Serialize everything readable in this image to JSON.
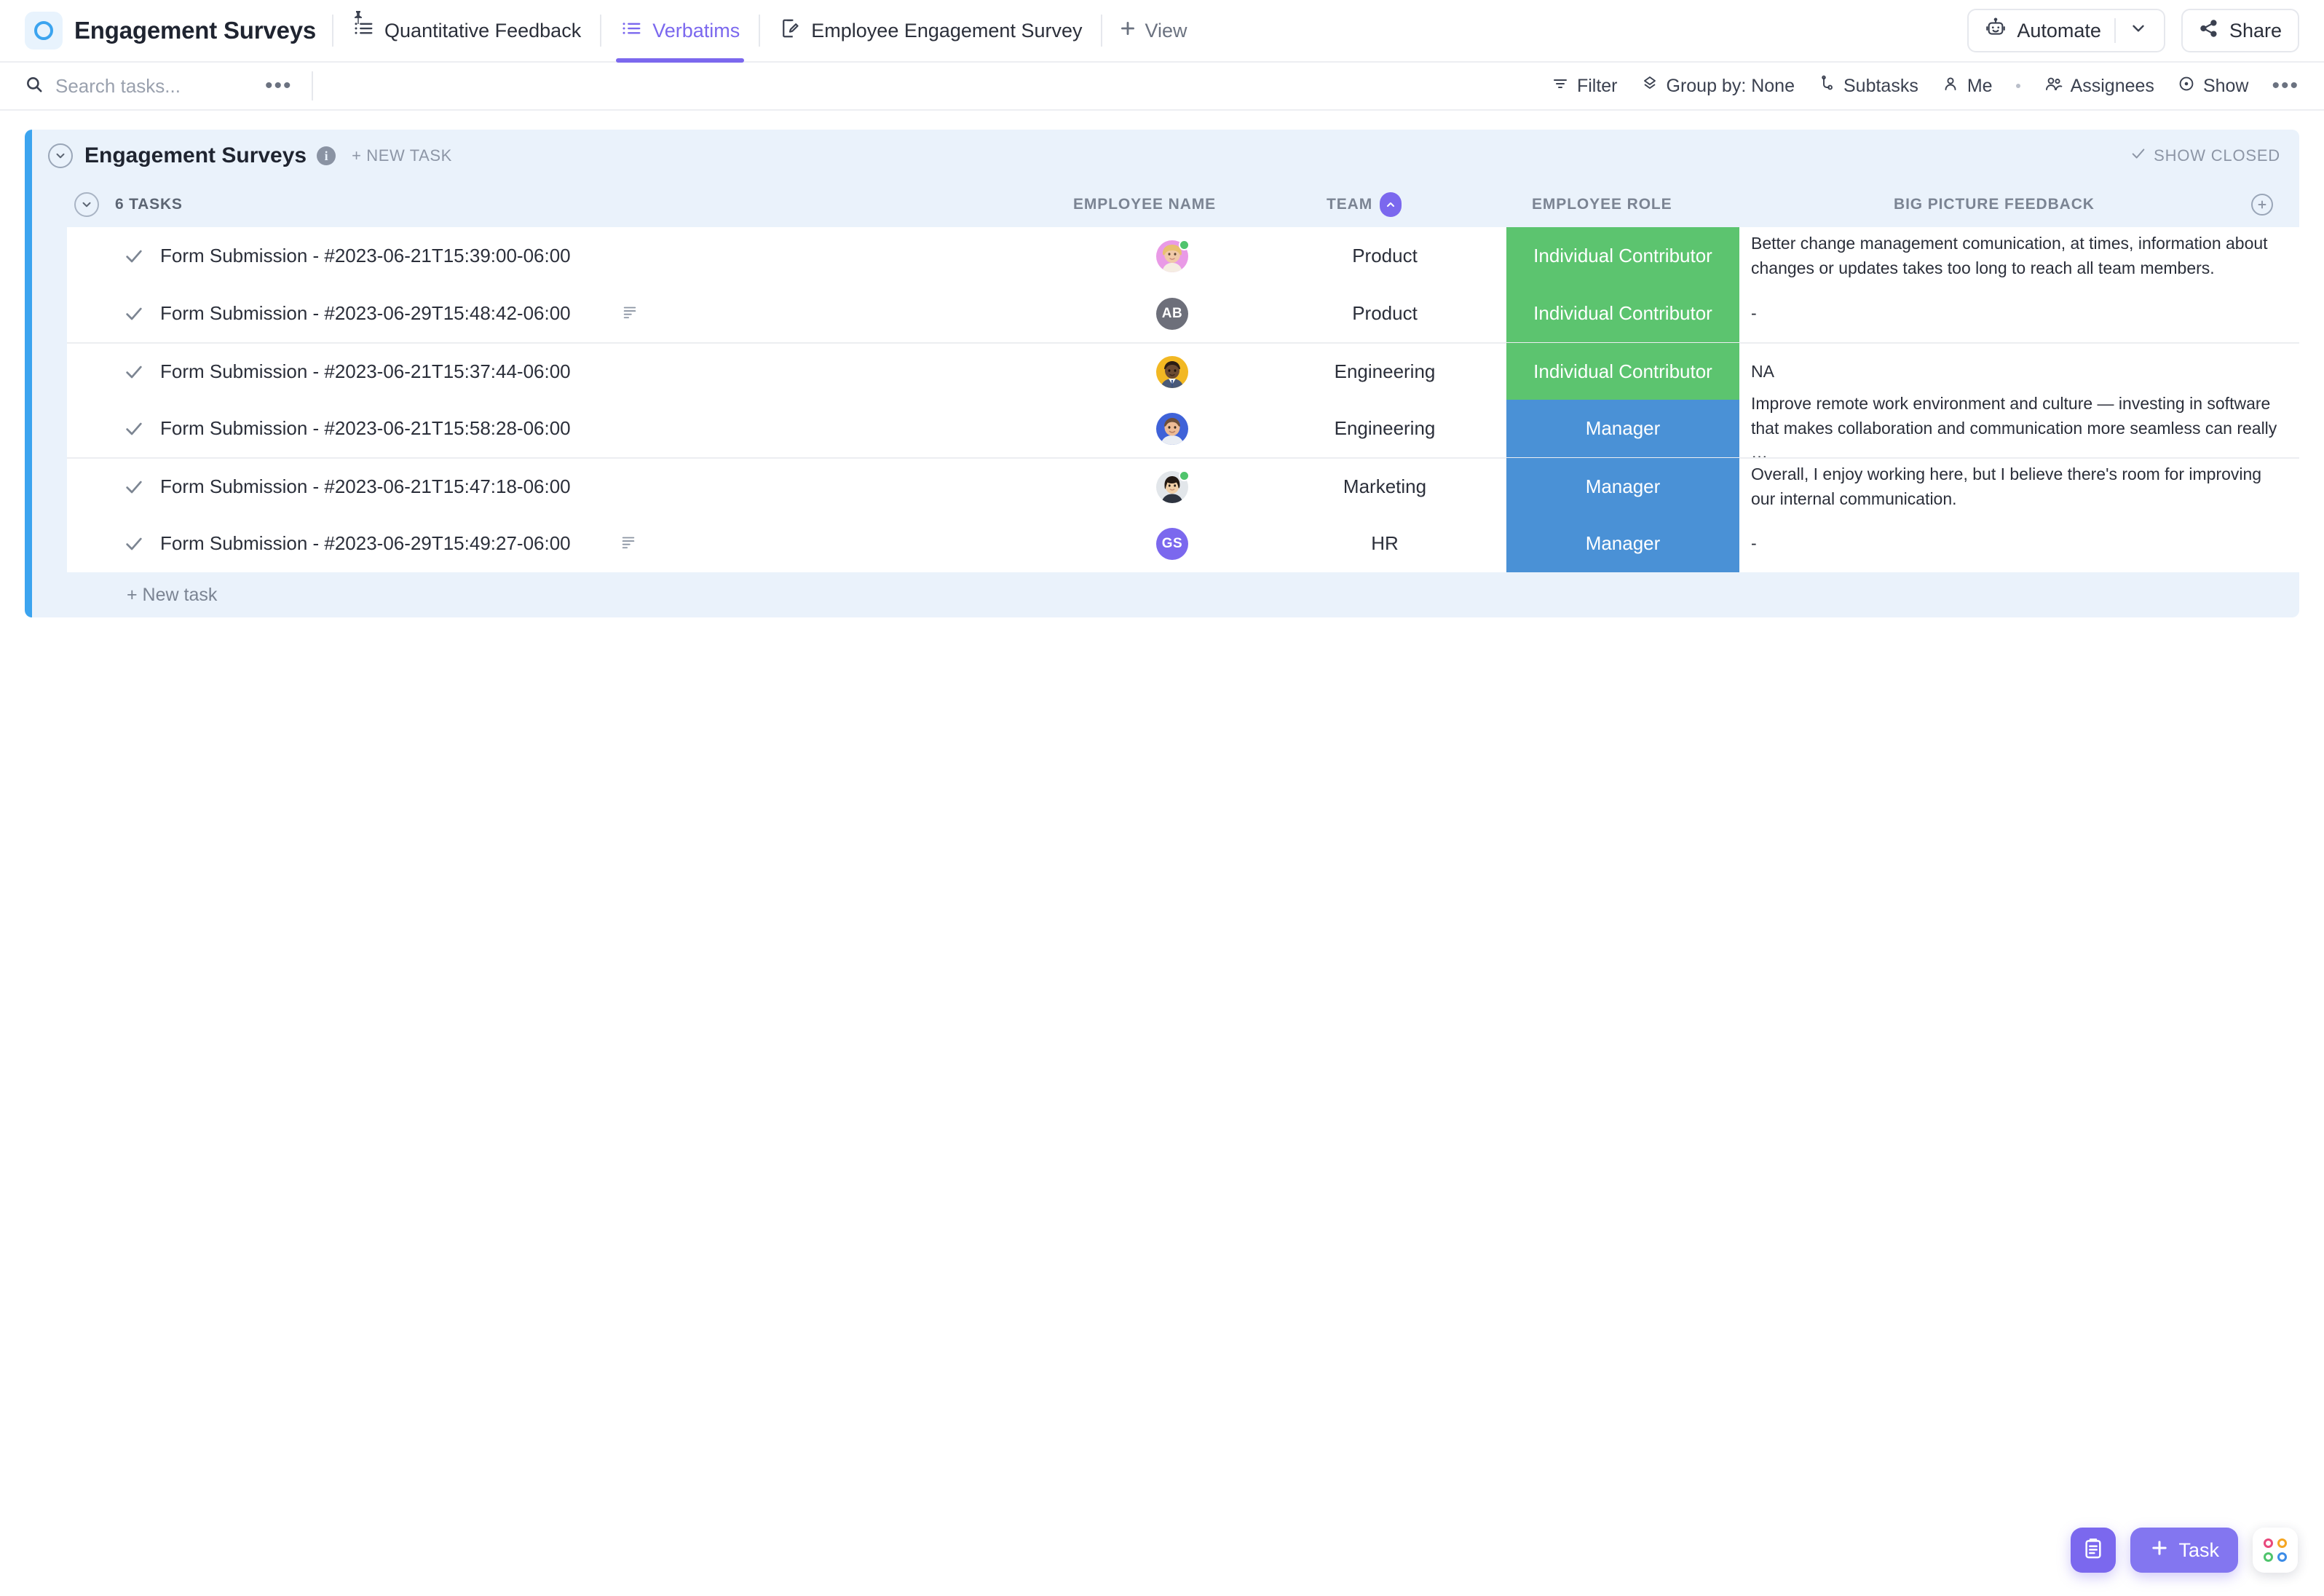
{
  "header": {
    "space_title": "Engagement Surveys",
    "logo_icon": "circle-ring-icon",
    "tabs": [
      {
        "label": "Quantitative Feedback",
        "icon": "list-view-icon",
        "pinned": true,
        "active": false
      },
      {
        "label": "Verbatims",
        "icon": "list-view-icon",
        "pinned": false,
        "active": true
      },
      {
        "label": "Employee Engagement Survey",
        "icon": "form-view-icon",
        "pinned": false,
        "active": false
      }
    ],
    "add_view_label": "View",
    "automate_label": "Automate",
    "share_label": "Share"
  },
  "toolbar": {
    "search_placeholder": "Search tasks...",
    "search_value": "",
    "more_label": "•••",
    "items": [
      {
        "label": "Filter",
        "icon": "filter-icon"
      },
      {
        "label": "Group by: None",
        "icon": "group-by-icon"
      },
      {
        "label": "Subtasks",
        "icon": "subtasks-icon"
      },
      {
        "label": "Me",
        "icon": "person-icon"
      },
      {
        "label": "Assignees",
        "icon": "people-icon"
      },
      {
        "label": "Show",
        "icon": "eye-icon"
      }
    ]
  },
  "list": {
    "name": "Engagement Surveys",
    "info_char": "i",
    "new_task_label": "+ NEW TASK",
    "show_closed_label": "SHOW CLOSED",
    "group_count_label": "6 TASKS",
    "columns": [
      {
        "key": "employee_name",
        "label": "EMPLOYEE NAME",
        "sorted": false
      },
      {
        "key": "team",
        "label": "TEAM",
        "sorted": true,
        "sort_dir": "asc"
      },
      {
        "key": "employee_role",
        "label": "EMPLOYEE ROLE",
        "sorted": false
      },
      {
        "key": "big_picture_feedback",
        "label": "BIG PICTURE FEEDBACK",
        "sorted": false
      }
    ],
    "add_column_icon": "plus-circle-icon",
    "footer_new_task_label": "+ New task",
    "role_colors": {
      "Individual Contributor": "#5cc46f",
      "Manager": "#4a91d6"
    },
    "accent_bar_color": "#3ca4ef",
    "panel_bg": "#eaf2fb",
    "rows": [
      {
        "task_name": "Form Submission - #2023-06-21T15:39:00-06:00",
        "has_description": false,
        "avatar": {
          "type": "photo",
          "variant": "woman-blonde",
          "bg": "#e99ae6",
          "online": true
        },
        "team": "Product",
        "employee_role": "Individual Contributor",
        "big_picture_feedback": "Better change management comunication, at times, information about changes or updates takes too long to reach all team members."
      },
      {
        "task_name": "Form Submission - #2023-06-29T15:48:42-06:00",
        "has_description": true,
        "avatar": {
          "type": "initials",
          "initials": "AB",
          "bg": "#6d6f7a",
          "online": false
        },
        "team": "Product",
        "employee_role": "Individual Contributor",
        "big_picture_feedback": "-"
      },
      {
        "task_name": "Form Submission - #2023-06-21T15:37:44-06:00",
        "has_description": false,
        "avatar": {
          "type": "photo",
          "variant": "man-suit",
          "bg": "#f2b823",
          "online": false
        },
        "team": "Engineering",
        "employee_role": "Individual Contributor",
        "big_picture_feedback": "NA"
      },
      {
        "task_name": "Form Submission - #2023-06-21T15:58:28-06:00",
        "has_description": false,
        "avatar": {
          "type": "photo",
          "variant": "man-blue",
          "bg": "#3f62d8",
          "online": false
        },
        "team": "Engineering",
        "employee_role": "Manager",
        "big_picture_feedback": "Improve remote work environment and culture — investing in software that makes collaboration and communication more seamless can really …"
      },
      {
        "task_name": "Form Submission - #2023-06-21T15:47:18-06:00",
        "has_description": false,
        "avatar": {
          "type": "photo",
          "variant": "woman-dark-hair",
          "bg": "#dfe3e8",
          "online": true
        },
        "team": "Marketing",
        "employee_role": "Manager",
        "big_picture_feedback": "Overall, I enjoy working here, but I believe there's room for improving our internal communication."
      },
      {
        "task_name": "Form Submission - #2023-06-29T15:49:27-06:00",
        "has_description": true,
        "avatar": {
          "type": "initials",
          "initials": "GS",
          "bg": "#7b68ee",
          "online": false
        },
        "team": "HR",
        "employee_role": "Manager",
        "big_picture_feedback": "-"
      }
    ]
  },
  "fabs": {
    "notepad_icon": "clipboard-icon",
    "task_label": "Task",
    "apps_icon": "apps-grid-icon"
  }
}
